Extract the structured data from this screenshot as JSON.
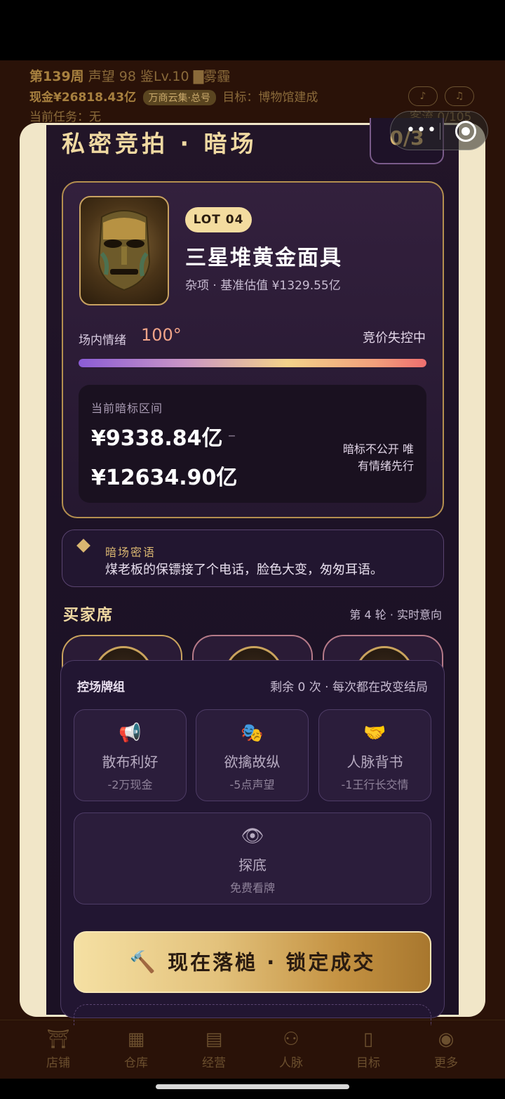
{
  "background": {
    "week": "第139周",
    "reputation_label": "声望",
    "reputation_value": "98",
    "appraise": "鉴Lv.10",
    "weather": "▇雾霾",
    "cash": "现金¥26818.43亿",
    "pill": "万商云集·总号",
    "goal": "目标：博物馆建成",
    "task": "当前任务：无",
    "flow": "客流 0/105",
    "sound_icon": "speaker-icon",
    "music_icon": "music-icon"
  },
  "capsule": {
    "more_icon": "more-dots-icon",
    "close_icon": "target-close-icon"
  },
  "modal": {
    "title": "私密竞拍 · 暗场",
    "counter": "0/3"
  },
  "lot": {
    "badge": "LOT 04",
    "name": "三星堆黄金面具",
    "meta": "杂项 · 基准估值 ¥1329.55亿",
    "image_icon": "golden-mask-image"
  },
  "mood": {
    "label": "场内情绪",
    "value": "100°",
    "level": 1.0,
    "status": "竞价失控中"
  },
  "range": {
    "label": "当前暗标区间",
    "low": "¥9338.84亿",
    "dash": "–",
    "high": "¥12634.90亿",
    "note": "暗标不公开 唯有情绪先行"
  },
  "whisper": {
    "title": "暗场密语",
    "text": "煤老板的保镖接了个电话，脸色大变，匆匆耳语。"
  },
  "seats": {
    "title": "买家席",
    "round": "第 4 轮 · 实时意向"
  },
  "control": {
    "title": "控场牌组",
    "remaining": "剩余 0 次 · 每次都在改变结局",
    "cards": [
      {
        "icon": "📢",
        "name": "散布利好",
        "cost": "-2万现金"
      },
      {
        "icon": "🎭",
        "name": "欲擒故纵",
        "cost": "-5点声望"
      },
      {
        "icon": "🤝",
        "name": "人脉背书",
        "cost": "-1王行长交情"
      }
    ],
    "peek": {
      "icon": "👁",
      "name": "探底",
      "cost": "免费看牌"
    }
  },
  "action": {
    "icon": "🔨",
    "label": "现在落槌 · 锁定成交"
  },
  "tabs": [
    {
      "icon": "⛩",
      "label": "店铺"
    },
    {
      "icon": "▦",
      "label": "仓库"
    },
    {
      "icon": "▤",
      "label": "经营"
    },
    {
      "icon": "⚇",
      "label": "人脉"
    },
    {
      "icon": "▯",
      "label": "目标"
    },
    {
      "icon": "◉",
      "label": "更多"
    }
  ],
  "colors": {
    "gold": "#f0d9a2",
    "frame": "#f1e6c8",
    "panel": "#1d1226",
    "mood_hot": "#f1a489"
  }
}
